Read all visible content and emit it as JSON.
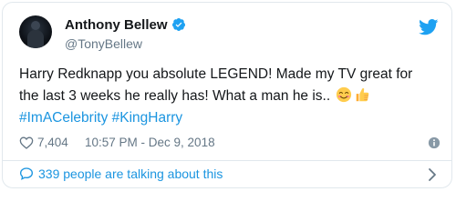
{
  "tweet": {
    "author_name": "Anthony Bellew",
    "author_handle": "@TonyBellew",
    "text_line1": "Harry Redknapp you absolute LEGEND! Made my TV great for",
    "text_line2": "the last 3 weeks he really has! What a man he is..",
    "hashtag1": "#ImACelebrity",
    "hashtag2": "#KingHarry",
    "likes": "7,404",
    "timestamp": "10:57 PM - Dec 9, 2018",
    "talking_text": "339 people are talking about this"
  },
  "icons": {
    "verified": "verified-badge-icon",
    "bird": "twitter-bird-icon",
    "heart": "heart-icon",
    "info": "info-icon",
    "chat": "speech-bubble-icon",
    "chevron": "chevron-right-icon",
    "emoji_smile": "smiling-face-icon",
    "emoji_thumbs": "thumbs-up-icon"
  },
  "colors": {
    "brand_blue": "#1da1f2",
    "link_blue": "#1b95e0",
    "text_primary": "#14171a",
    "text_secondary": "#657786",
    "border": "#e1e8ed"
  }
}
